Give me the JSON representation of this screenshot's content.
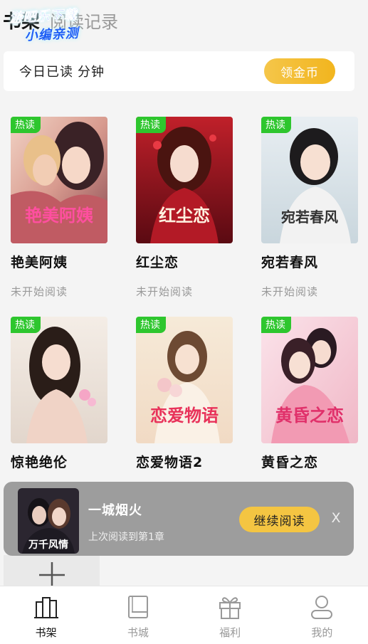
{
  "header": {
    "tab_shelf": "书架",
    "tab_history": "阅读记录",
    "watermark_line1": "游吧乐下载",
    "watermark_line2": "小编亲测"
  },
  "reading": {
    "label": "今日已读",
    "unit": "分钟",
    "coin_button": "领金币"
  },
  "books": [
    {
      "badge": "热读",
      "title": "艳美阿姨",
      "status": "未开始阅读",
      "cover_text": "艳美阿姨",
      "cover_text_color": "#ff4fa0"
    },
    {
      "badge": "热读",
      "title": "红尘恋",
      "status": "未开始阅读",
      "cover_text": "红尘恋",
      "cover_text_color": "#fff2e0"
    },
    {
      "badge": "热读",
      "title": "宛若春风",
      "status": "未开始阅读",
      "cover_text": "宛若春风",
      "cover_text_color": "#333333"
    },
    {
      "badge": "热读",
      "title": "惊艳绝伦",
      "status": "",
      "cover_text": "",
      "cover_text_color": "#ffffff"
    },
    {
      "badge": "热读",
      "title": "恋爱物语2",
      "status": "",
      "cover_text": "恋爱物语",
      "cover_text_color": "#e8325a"
    },
    {
      "badge": "热读",
      "title": "黄昏之恋",
      "status": "",
      "cover_text": "黄昏之恋",
      "cover_text_color": "#e0306a"
    }
  ],
  "continue_reading": {
    "title": "一城烟火",
    "progress": "上次阅读到第1章",
    "button": "继续阅读",
    "close": "X",
    "cover_text": "万千风情"
  },
  "nav": [
    {
      "label": "书架",
      "icon": "bookshelf-icon",
      "active": true
    },
    {
      "label": "书城",
      "icon": "book-icon",
      "active": false
    },
    {
      "label": "福利",
      "icon": "gift-icon",
      "active": false
    },
    {
      "label": "我的",
      "icon": "profile-icon",
      "active": false
    }
  ],
  "colors": {
    "accent": "#f4c542",
    "badge": "#2ec62e",
    "muted": "#999999"
  }
}
